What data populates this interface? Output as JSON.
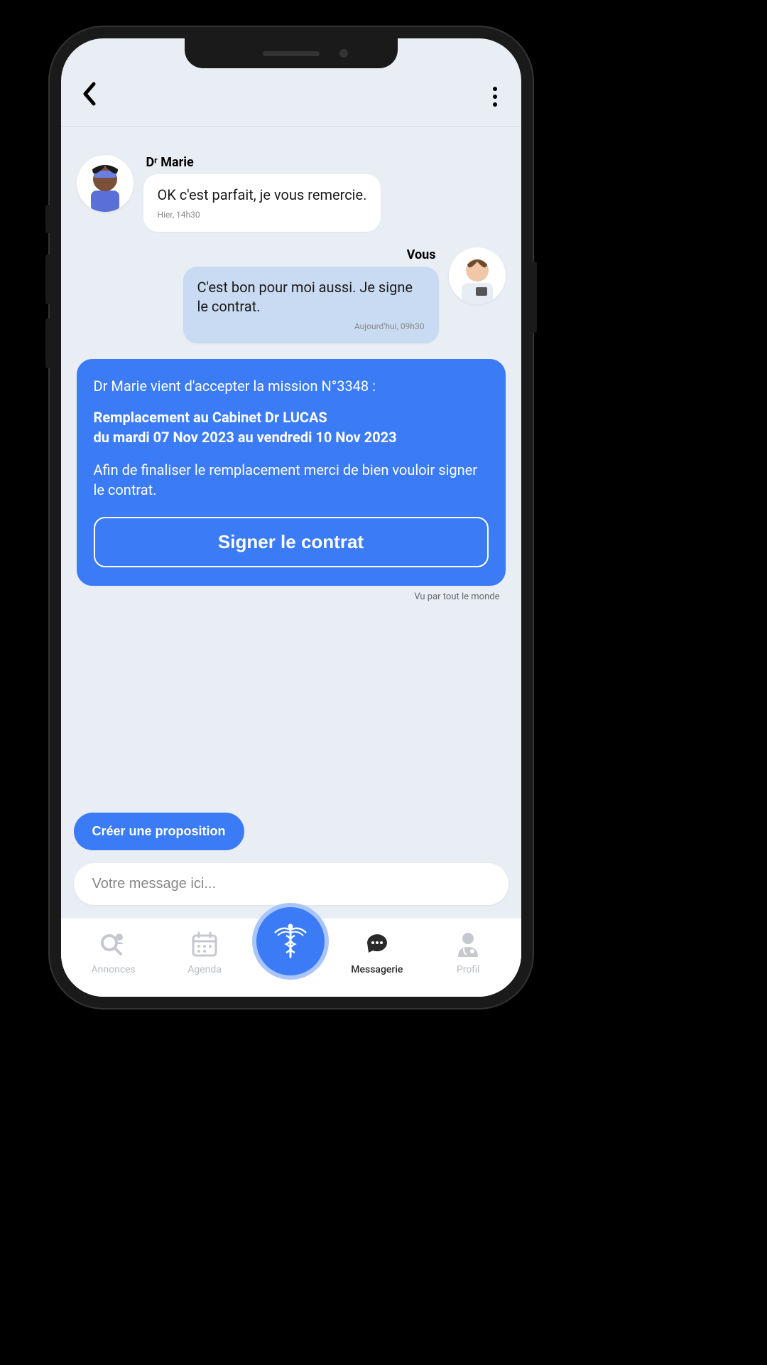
{
  "chat": {
    "sender1_name": "Dʳ Marie",
    "msg1_text": "OK c'est parfait, je vous remercie.",
    "msg1_time": "Hier, 14h30",
    "sender2_name": "Vous",
    "msg2_text": "C'est bon pour moi aussi. Je signe le contrat.",
    "msg2_time": "Aujourd'hui, 09h30"
  },
  "system": {
    "intro": "Dr Marie vient d'accepter la mission N°3348 :",
    "title_line1": "Remplacement au Cabinet Dr LUCAS",
    "title_line2": "du mardi 07 Nov 2023 au  vendredi 10 Nov 2023",
    "body": "Afin de finaliser le remplacement merci de bien vouloir signer le contrat.",
    "cta": "Signer le contrat"
  },
  "read_receipt": "Vu par tout le monde",
  "compose": {
    "propose_label": "Créer une proposition",
    "placeholder": "Votre message ici..."
  },
  "tabs": {
    "annonces": "Annonces",
    "agenda": "Agenda",
    "messagerie": "Messagerie",
    "profil": "Profil"
  }
}
